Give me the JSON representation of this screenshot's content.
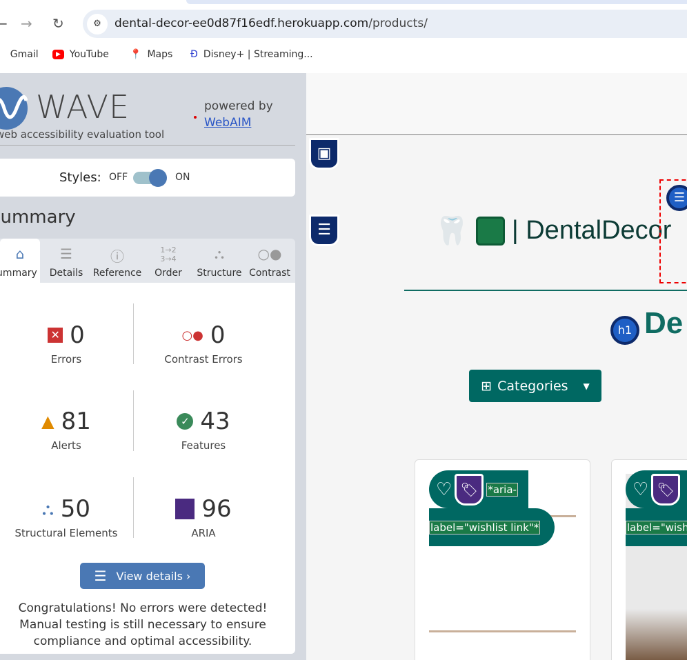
{
  "browser": {
    "url_host": "dental-decor-ee0d87f16edf.herokuapp.com",
    "url_path": "/products/",
    "bookmarks": [
      {
        "label": "Gmail"
      },
      {
        "label": "YouTube"
      },
      {
        "label": "Maps"
      },
      {
        "label": "Disney+ | Streaming..."
      }
    ]
  },
  "wave": {
    "title": "WAVE",
    "subtitle": "web accessibility evaluation tool",
    "powered_by": "powered by",
    "webaim": "WebAIM",
    "styles_label": "Styles:",
    "off": "OFF",
    "on": "ON",
    "summary_heading": "Summary",
    "tabs": [
      {
        "label": "Summary"
      },
      {
        "label": "Details"
      },
      {
        "label": "Reference"
      },
      {
        "label": "Order"
      },
      {
        "label": "Structure"
      },
      {
        "label": "Contrast"
      }
    ],
    "stats": [
      {
        "value": "0",
        "label": "Errors"
      },
      {
        "value": "0",
        "label": "Contrast Errors"
      },
      {
        "value": "81",
        "label": "Alerts"
      },
      {
        "value": "43",
        "label": "Features"
      },
      {
        "value": "50",
        "label": "Structural Elements"
      },
      {
        "value": "96",
        "label": "ARIA"
      }
    ],
    "view_details": "View details ›",
    "congrats": "Congratulations! No errors were detected! Manual testing is still necessary to ensure compliance and optimal accessibility."
  },
  "site": {
    "brand": "| DentalDecor",
    "h1_badge": "h1",
    "h1_partial": "De",
    "categories": "Categories",
    "aria_label_1": "*aria-",
    "aria_label_2": "label=\"wishlist link\"*",
    "aria_label_2_partial": "label=\"wish"
  }
}
